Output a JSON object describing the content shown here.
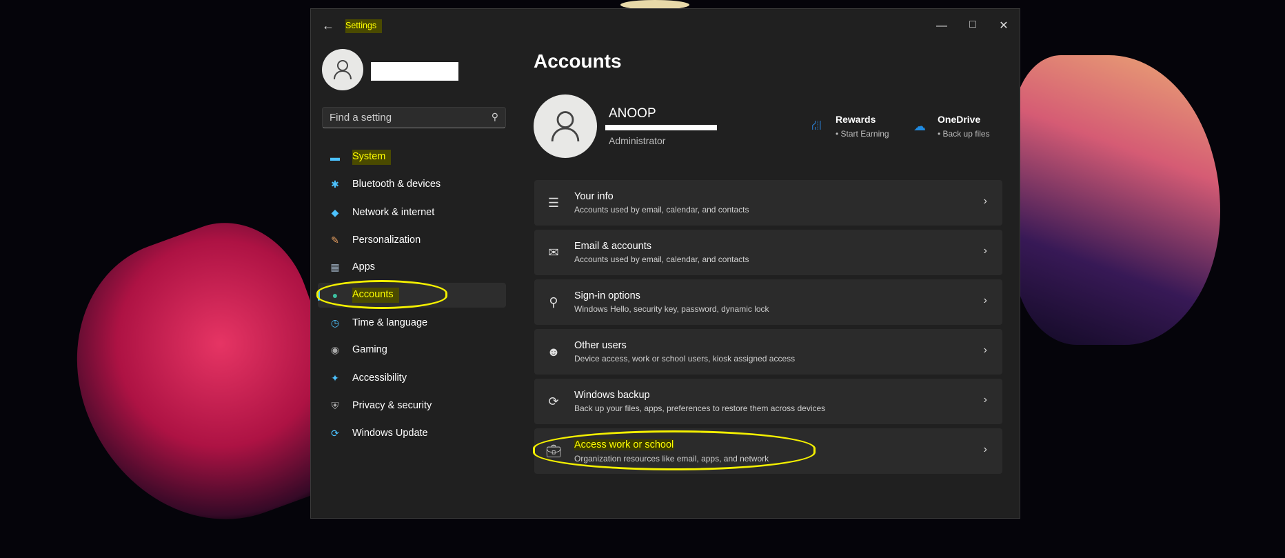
{
  "window": {
    "title": "Settings",
    "controls": [
      "minimize",
      "maximize",
      "close"
    ]
  },
  "sidebar": {
    "search_placeholder": "Find a setting",
    "items": [
      {
        "label": "System",
        "icon": "monitor-icon"
      },
      {
        "label": "Bluetooth & devices",
        "icon": "bluetooth-icon"
      },
      {
        "label": "Network & internet",
        "icon": "wifi-icon"
      },
      {
        "label": "Personalization",
        "icon": "brush-icon"
      },
      {
        "label": "Apps",
        "icon": "apps-icon"
      },
      {
        "label": "Accounts",
        "icon": "person-icon",
        "selected": true
      },
      {
        "label": "Time & language",
        "icon": "globe-clock-icon"
      },
      {
        "label": "Gaming",
        "icon": "gamepad-icon"
      },
      {
        "label": "Accessibility",
        "icon": "accessibility-icon"
      },
      {
        "label": "Privacy & security",
        "icon": "shield-icon"
      },
      {
        "label": "Windows Update",
        "icon": "update-icon"
      }
    ]
  },
  "main": {
    "title": "Accounts",
    "profile": {
      "name": "ANOOP",
      "role": "Administrator"
    },
    "rewards": {
      "title": "Rewards",
      "subtitle": "Start Earning"
    },
    "onedrive": {
      "title": "OneDrive",
      "subtitle": "Back up files"
    },
    "cards": [
      {
        "title": "Your info",
        "subtitle": "Accounts used by email, calendar, and contacts"
      },
      {
        "title": "Email & accounts",
        "subtitle": "Accounts used by email, calendar, and contacts"
      },
      {
        "title": "Sign-in options",
        "subtitle": "Windows Hello, security key, password, dynamic lock"
      },
      {
        "title": "Other users",
        "subtitle": "Device access, work or school users, kiosk assigned access"
      },
      {
        "title": "Windows backup",
        "subtitle": "Back up your files, apps, preferences to restore them across devices"
      },
      {
        "title": "Access work or school",
        "subtitle": "Organization resources like email, apps, and network"
      }
    ]
  },
  "colors": {
    "accent": "#4cc2ff",
    "highlight": "#f4f000"
  }
}
